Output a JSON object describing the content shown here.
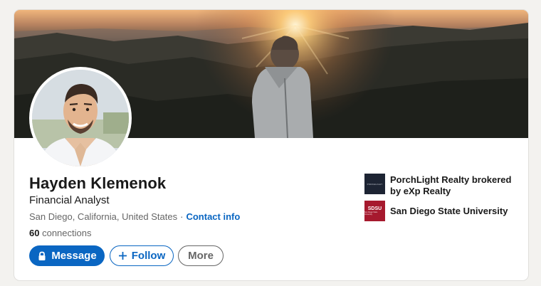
{
  "profile": {
    "name": "Hayden Klemenok",
    "headline": "Financial Analyst",
    "location": "San Diego, California, United States",
    "separator": "·",
    "contact_info": "Contact info",
    "connections_count": "60",
    "connections_label": "connections"
  },
  "actions": {
    "message": "Message",
    "follow": "Follow",
    "more": "More"
  },
  "organizations": [
    {
      "name_line1": "PorchLight Realty brokered",
      "name_line2": "by eXp Realty",
      "logo_text": "PORCHLIGHT"
    },
    {
      "name_line1": "San Diego State University",
      "logo_text": "SDSU",
      "logo_subtext": "San Diego State University"
    }
  ],
  "icons": {
    "message": "lock-icon",
    "follow": "plus-icon"
  },
  "colors": {
    "accent": "#0a66c2",
    "text_primary": "#191919",
    "text_secondary": "#666666",
    "page_bg": "#f3f2ef",
    "sdsu_red": "#a6192e",
    "porchlight_navy": "#1d2433"
  }
}
